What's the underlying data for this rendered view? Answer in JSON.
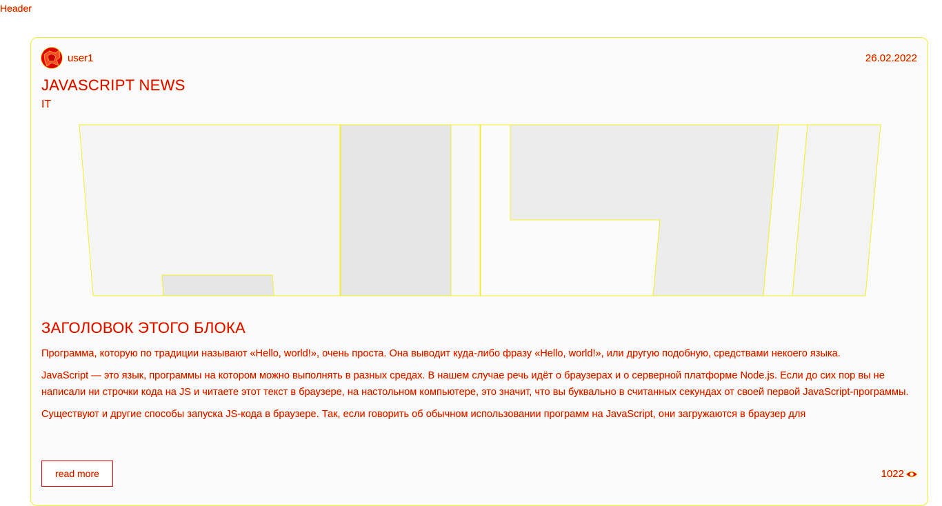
{
  "header": {
    "label": "Header"
  },
  "post": {
    "author": {
      "name": "user1"
    },
    "date": "26.02.2022",
    "title": "JAVASCRIPT NEWS",
    "category": "IT",
    "block_heading": "ЗАГОЛОВОК ЭТОГО БЛОКА",
    "paragraphs": [
      "Программа, которую по традиции называют «Hello, world!», очень проста. Она выводит куда-либо фразу «Hello, world!», или другую подобную, средствами некоего языка.",
      "JavaScript — это язык, программы на котором можно выполнять в разных средах. В нашем случае речь идёт о браузерах и о серверной платформе Node.js. Если до сих пор вы не написали ни строчки кода на JS и читаете этот текст в браузере, на настольном компьютере, это значит, что вы буквально в считанных секундах от своей первой JavaScript-программы.",
      "Существуют и другие способы запуска JS-кода в браузере. Так, если говорить об обычном использовании программ на JavaScript, они загружаются в браузер для"
    ],
    "read_more_label": "read more",
    "views": "1022",
    "icons": {
      "avatar": "avatar-image",
      "views": "eye-icon"
    }
  },
  "colors": {
    "text": "#e00000",
    "outline": "#f2ef2a",
    "card_bg": "#fbfbfb",
    "image_fill_light": "#f5f5f5",
    "image_fill_dark": "#e6e6e6"
  }
}
